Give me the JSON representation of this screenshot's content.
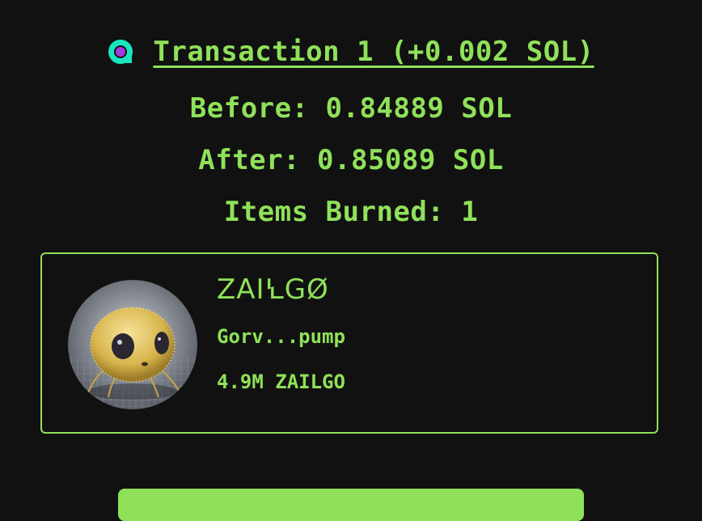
{
  "transaction": {
    "title": "Transaction 1 (+0.002 SOL)",
    "logo_icon": "solana-explorer-icon",
    "before": "Before: 0.84889 SOL",
    "after": "After: 0.85089 SOL",
    "items_burned": "Items Burned: 1"
  },
  "token": {
    "name": "ZAIꝆGØ",
    "address": "Gorv...pump",
    "amount": "4.9M ZAILGO",
    "image_icon": "fuzzy-yellow-creature-image"
  },
  "colors": {
    "background": "#111111",
    "accent": "#8fe15a",
    "logo_ring": "#19e6c1",
    "logo_center": "#a23be0"
  }
}
